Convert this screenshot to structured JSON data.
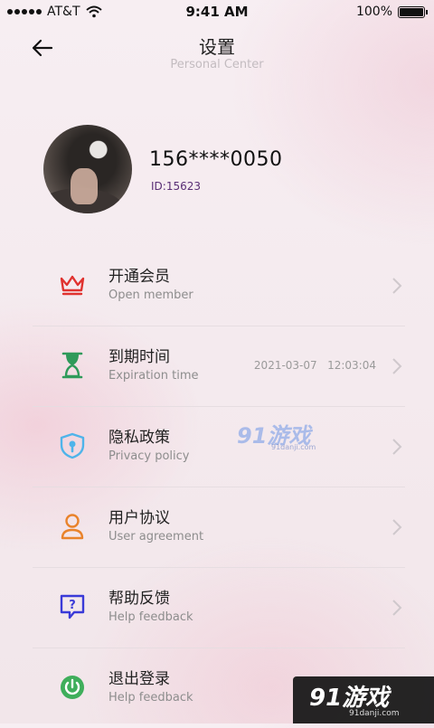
{
  "status_bar": {
    "carrier": "AT&T",
    "time": "9:41 AM",
    "battery": "100%"
  },
  "header": {
    "title": "设置",
    "subtitle": "Personal Center"
  },
  "profile": {
    "phone": "156****0050",
    "id": "ID:15623"
  },
  "menu": [
    {
      "title": "开通会员",
      "subtitle": "Open member",
      "value": "",
      "icon": "crown-icon",
      "color": "#e0322f"
    },
    {
      "title": "到期时间",
      "subtitle": "Expiration time",
      "value": "2021-03-07   12:03:04",
      "icon": "hourglass-icon",
      "color": "#2f9a5a"
    },
    {
      "title": "隐私政策",
      "subtitle": "Privacy policy",
      "value": "",
      "icon": "shield-lock-icon",
      "color": "#4fb4ea"
    },
    {
      "title": "用户协议",
      "subtitle": "User agreement",
      "value": "",
      "icon": "user-icon",
      "color": "#e9832b"
    },
    {
      "title": "帮助反馈",
      "subtitle": "Help feedback",
      "value": "",
      "icon": "help-chat-icon",
      "color": "#3a3ad8"
    },
    {
      "title": "退出登录",
      "subtitle": "Help feedback",
      "value": "",
      "icon": "power-icon",
      "color": "#3fae5b"
    }
  ],
  "watermarks": {
    "center_logo": "91游戏",
    "center_url": "91danji.com",
    "corner_logo": "91游戏",
    "corner_url": "91danji.com"
  }
}
